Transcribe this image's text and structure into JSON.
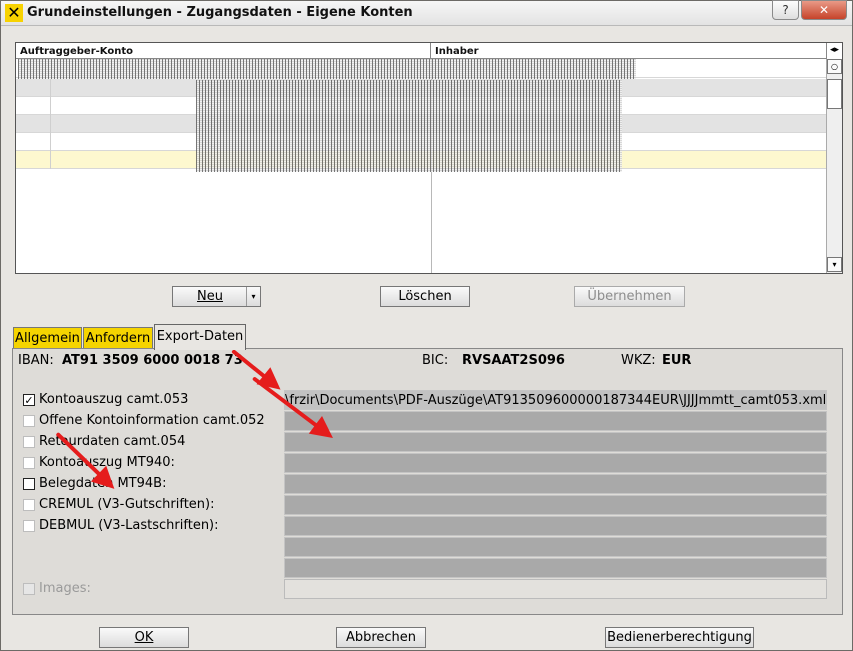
{
  "window": {
    "title": "Grundeinstellungen - Zugangsdaten - Eigene Konten",
    "logo_glyph": "✕",
    "help_label": "?",
    "close_label": "✕"
  },
  "table": {
    "columns": [
      "Auftraggeber-Konto",
      "Inhaber"
    ],
    "header_control": "◂▸",
    "scroll_up": "○",
    "scroll_down": "▾"
  },
  "table_buttons": {
    "neu": "Neu",
    "neu_arrow": "▾",
    "loeschen": "Löschen",
    "uebernehmen": "Übernehmen"
  },
  "tabs": {
    "allgemein": "Allgemein",
    "anfordern": "Anfordern",
    "export": "Export-Daten"
  },
  "info": {
    "iban_label": "IBAN:",
    "iban_value": "AT91 3509 6000 0018 73",
    "bic_label": "BIC:",
    "bic_value": "RVSAAT2S096",
    "wkz_label": "WKZ:",
    "wkz_value": "EUR"
  },
  "exports": [
    {
      "label": "Kontoauszug camt.053",
      "checked": true,
      "check_glyph": "✓"
    },
    {
      "label": "Offene Kontoinformation camt.052",
      "checked": false
    },
    {
      "label": "Retourdaten camt.054",
      "checked": false
    },
    {
      "label": "Kontoauszug MT940:",
      "checked": false
    },
    {
      "label": "Belegdaten MT94B:",
      "checked": false
    },
    {
      "label": "CREMUL (V3-Gutschriften):",
      "checked": false
    },
    {
      "label": "DEBMUL (V3-Lastschriften):",
      "checked": false
    }
  ],
  "export_path": "\\frzir\\Documents\\PDF-Auszüge\\AT913509600000187344EUR\\JJJJmmtt_camt053.xml",
  "images_label": "Images:",
  "footer_buttons": {
    "ok": "OK",
    "abbrechen": "Abbrechen",
    "bediener": "Bedienerberechtigung"
  },
  "colors": {
    "tab_yellow": "#f5d400",
    "selected_row": "#fdf8cf",
    "annotation_arrow": "#e51c1c"
  }
}
